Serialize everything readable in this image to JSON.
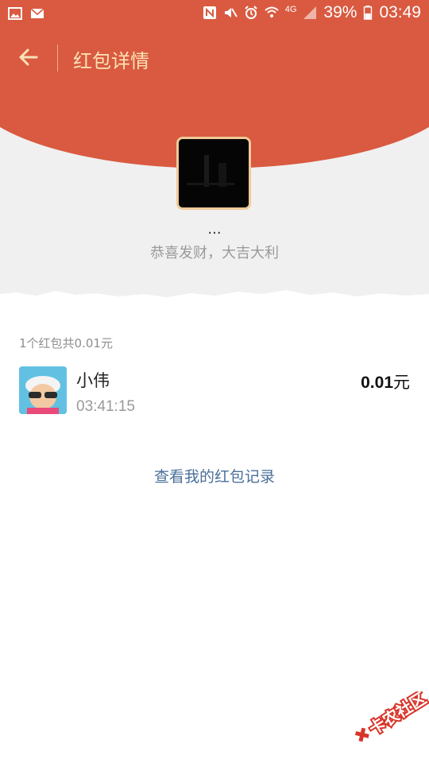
{
  "status_bar": {
    "battery": "39%",
    "time": "03:49",
    "network": "4G"
  },
  "header": {
    "title": "红包详情"
  },
  "sender": {
    "name": "...",
    "greeting": "恭喜发财，大吉大利"
  },
  "summary": "1个红包共0.01元",
  "records": [
    {
      "name": "小伟",
      "time": "03:41:15",
      "amount": "0.01",
      "unit": "元"
    }
  ],
  "view_records_label": "查看我的红包记录",
  "watermark": "卡农社区",
  "colors": {
    "header_red": "#d95a40",
    "title_gold": "#fbe3b7",
    "link_blue": "#4a6f9a"
  }
}
